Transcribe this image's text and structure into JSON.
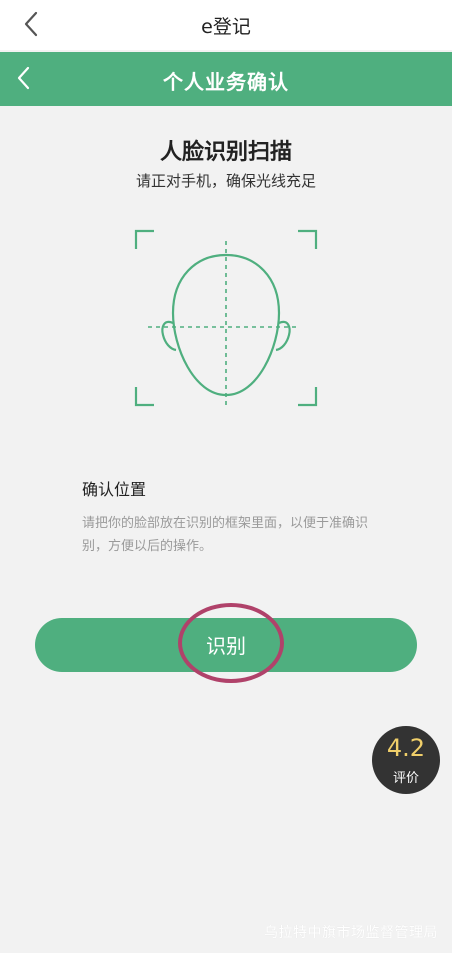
{
  "top_bar": {
    "title": "e登记",
    "back_icon": "chevron-left-icon"
  },
  "header": {
    "title": "个人业务确认",
    "back_icon": "chevron-left-icon",
    "background_color": "#4faf7f"
  },
  "scan": {
    "heading": "人脸识别扫描",
    "subheading": "请正对手机，确保光线充足",
    "face_icon": "face-outline-icon",
    "frame_color": "#4faf7f"
  },
  "instructions": {
    "title": "确认位置",
    "description": "请把你的脸部放在识别的框架里面，以便于准确识别，方便以后的操作。"
  },
  "action": {
    "button_label": "识别",
    "highlight_color": "#b0426a"
  },
  "rating": {
    "score": "4.2",
    "label": "评价"
  },
  "watermark": "乌拉特中旗市场监督管理局"
}
